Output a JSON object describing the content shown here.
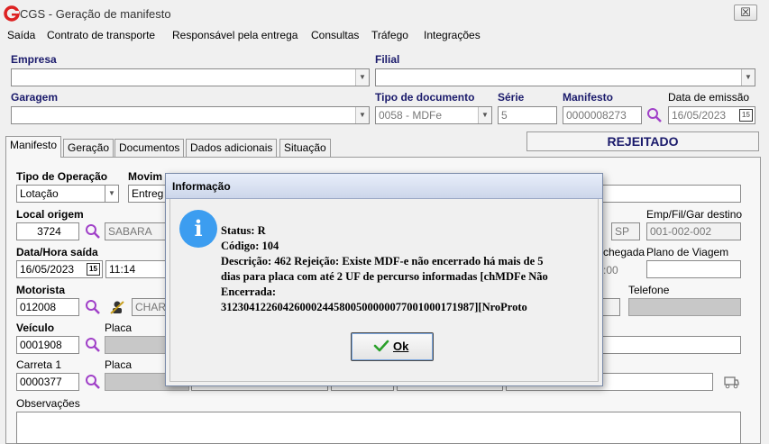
{
  "window": {
    "title": "CGS - Geração de manifesto",
    "close": "☒"
  },
  "menu": [
    "Saída",
    "Contrato de transporte",
    "Responsável pela entrega",
    "Consultas",
    "Tráfego",
    "Integrações"
  ],
  "header": {
    "empresa_label": "Empresa",
    "filial_label": "Filial",
    "garagem_label": "Garagem",
    "tipo_doc_label": "Tipo de documento",
    "serie_label": "Série",
    "manifesto_label": "Manifesto",
    "data_emissao_label": "Data de emissão",
    "tipo_doc_value": "0058 - MDFe",
    "serie_value": "5",
    "manifesto_value": "0000008273",
    "data_emissao_value": "16/05/2023",
    "cal_icon": "15"
  },
  "tabs": [
    "Manifesto",
    "Geração",
    "Documentos",
    "Dados adicionais",
    "Situação"
  ],
  "status": "REJEITADO",
  "form": {
    "tipo_operacao_label": "Tipo de Operação",
    "tipo_operacao_value": "Lotação",
    "movimento_label": "Movim",
    "movimento_value": "Entreg",
    "local_origem_label": "Local origem",
    "local_origem_code": "3724",
    "local_origem_name": "SABARA",
    "uf_value": "SP",
    "emp_destino_label": "Emp/Fil/Gar destino",
    "emp_destino_value": "001-002-002",
    "data_saida_label": "Data/Hora saída",
    "data_saida_value": "16/05/2023",
    "hora_saida_value": "11:14",
    "chegada_label": "chegada",
    "chegada_value": ":00",
    "plano_label": "Plano de Viagem",
    "motorista_label": "Motorista",
    "motorista_code": "012008",
    "motorista_name": "CHAR",
    "telefone_label": "Telefone",
    "veiculo_label": "Veículo",
    "veiculo_code": "0001908",
    "placa_label": "Placa",
    "carreta_label": "Carreta 1",
    "carreta_code": "0000377",
    "placa2_label": "Placa",
    "observacoes_label": "Observações"
  },
  "dialog": {
    "title": "Informação",
    "icon": "i",
    "lines": [
      "Status: R",
      "Código: 104",
      "Descrição: 462 Rejeição: Existe MDF-e não encerrado há mais de 5",
      "dias para placa com até 2 UF de percurso informadas [chMDFe Não",
      "Encerrada:",
      "31230412260426000244580050000007700100017198​7][NroProto"
    ],
    "ok_label": "Ok"
  }
}
